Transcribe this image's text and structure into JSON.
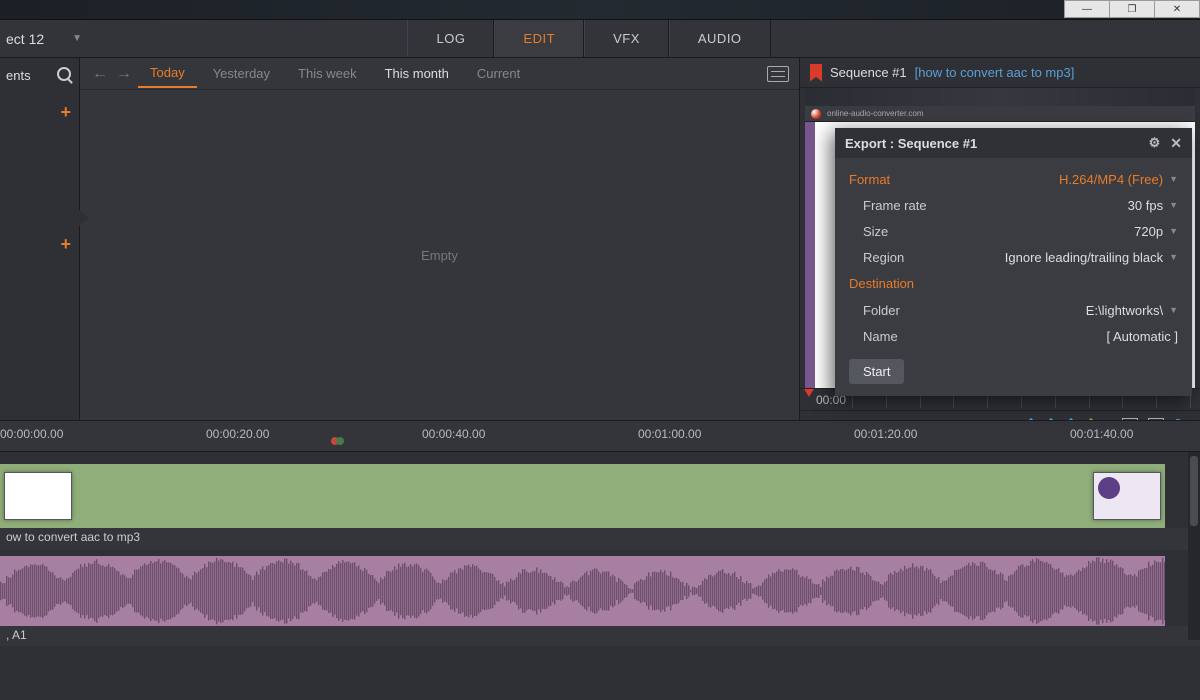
{
  "window": {
    "minimize": "—",
    "maximize": "❐",
    "close": "✕"
  },
  "project": {
    "name": "ect 12"
  },
  "menuTabs": {
    "log": "LOG",
    "edit": "EDIT",
    "vfx": "VFX",
    "audio": "AUDIO"
  },
  "leftPanel": {
    "label": "ents"
  },
  "filters": {
    "today": "Today",
    "yesterday": "Yesterday",
    "thisWeek": "This week",
    "thisMonth": "This month",
    "current": "Current",
    "empty": "Empty"
  },
  "sequence": {
    "label": "Sequence #1",
    "link": "[how to convert aac to mp3]",
    "timecodeTop": "00:00",
    "timecode": "00:00:00.00"
  },
  "export": {
    "title": "Export : Sequence #1",
    "formatLabel": "Format",
    "formatValue": "H.264/MP4 (Free)",
    "frameRateLabel": "Frame rate",
    "frameRateValue": "30 fps",
    "sizeLabel": "Size",
    "sizeValue": "720p",
    "regionLabel": "Region",
    "regionValue": "Ignore leading/trailing black",
    "destinationHeader": "Destination",
    "folderLabel": "Folder",
    "folderValue": "E:\\lightworks\\",
    "nameLabel": "Name",
    "nameValue": "[ Automatic ]",
    "start": "Start"
  },
  "timeline": {
    "marks": [
      "00:00:00.00",
      "00:00:20.00",
      "00:00:40.00",
      "00:01:00.00",
      "00:01:20.00",
      "00:01:40.00"
    ],
    "videoClip": "ow to convert aac to mp3",
    "audioClip": ", A1"
  }
}
